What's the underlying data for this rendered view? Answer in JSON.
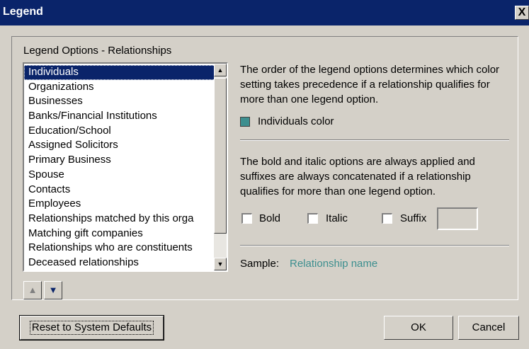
{
  "window": {
    "title": "Legend",
    "close_glyph": "X"
  },
  "group": {
    "label": "Legend Options - Relationships"
  },
  "list": {
    "items": [
      "Individuals",
      "Organizations",
      "Businesses",
      "Banks/Financial Institutions",
      "Education/School",
      "Assigned Solicitors",
      "Primary Business",
      "Spouse",
      "Contacts",
      "Employees",
      "Relationships matched by this orga",
      "Matching gift companies",
      "Relationships who are constituents",
      "Deceased relationships"
    ],
    "selected": "Individuals"
  },
  "order_text": "The order of the legend options determines which color setting takes precedence if a relationship qualifies for more than one legend option.",
  "color": {
    "label": "Individuals color",
    "value": "#3d8f8f"
  },
  "bold_text": "The bold and italic options are always applied and suffixes are always concatenated if a relationship qualifies for more than one legend option.",
  "options": {
    "bold": "Bold",
    "italic": "Italic",
    "suffix": "Suffix",
    "suffix_value": ""
  },
  "sample": {
    "label": "Sample:",
    "value": "Relationship name"
  },
  "buttons": {
    "reset": "Reset to System Defaults",
    "ok": "OK",
    "cancel": "Cancel"
  },
  "icons": {
    "scroll_up": "▲",
    "scroll_down": "▼",
    "move_up": "▲",
    "move_down": "▼"
  },
  "colors": {
    "title_bar": "#0a246a",
    "selection": "#0a246a",
    "accent": "#3d8f8f"
  }
}
